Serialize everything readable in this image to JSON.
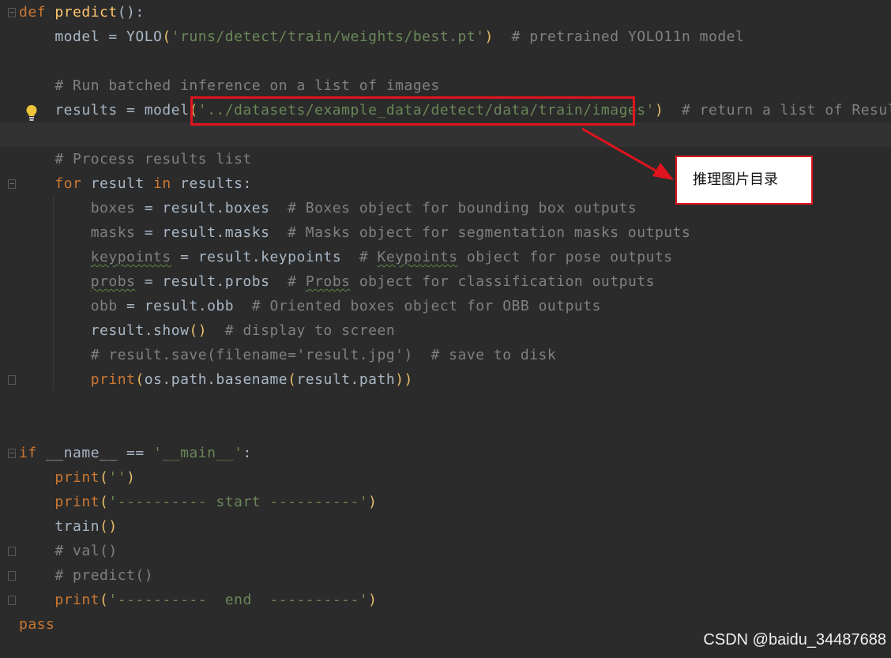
{
  "editor": {
    "lines": [
      {
        "segments": [
          {
            "t": "def",
            "c": "kw"
          },
          {
            "t": " "
          },
          {
            "t": "predict",
            "c": "fn"
          },
          {
            "t": "():"
          }
        ]
      },
      {
        "segments": [
          {
            "t": "    model = "
          },
          {
            "t": "YOLO",
            "c": "id"
          },
          {
            "t": "(",
            "c": "par"
          },
          {
            "t": "'runs/detect/train/weights/best.pt'",
            "c": "str"
          },
          {
            "t": ")",
            "c": "par"
          },
          {
            "t": "  # pretrained YOLO11n model",
            "c": "cmt"
          }
        ]
      },
      {
        "segments": []
      },
      {
        "segments": [
          {
            "t": "    # Run batched inference on a list of images",
            "c": "cmt"
          }
        ]
      },
      {
        "segments": [
          {
            "t": "    results = model"
          },
          {
            "t": "(",
            "c": "par"
          },
          {
            "t": "'../datasets/example_data/detect/data/train/images'",
            "c": "str"
          },
          {
            "t": ")",
            "c": "par"
          },
          {
            "t": "  # return a list of Results objects",
            "c": "cmt"
          }
        ]
      },
      {
        "segments": [],
        "current": true
      },
      {
        "segments": [
          {
            "t": "    # Process results list",
            "c": "cmt"
          }
        ]
      },
      {
        "segments": [
          {
            "t": "    "
          },
          {
            "t": "for",
            "c": "kw"
          },
          {
            "t": " result "
          },
          {
            "t": "in",
            "c": "kw"
          },
          {
            "t": " results:"
          }
        ]
      },
      {
        "segments": [
          {
            "t": "        "
          },
          {
            "t": "boxes",
            "c": "dim"
          },
          {
            "t": " = result.boxes"
          },
          {
            "t": "  # Boxes object for bounding box outputs",
            "c": "cmt"
          }
        ]
      },
      {
        "segments": [
          {
            "t": "        "
          },
          {
            "t": "masks",
            "c": "dim"
          },
          {
            "t": " = result.masks"
          },
          {
            "t": "  # Masks object for segmentation masks outputs",
            "c": "cmt"
          }
        ]
      },
      {
        "segments": [
          {
            "t": "        "
          },
          {
            "t": "keypoints",
            "c": "dim typo"
          },
          {
            "t": " = result.keypoints"
          },
          {
            "t": "  # ",
            "c": "cmt"
          },
          {
            "t": "Keypoints",
            "c": "cmt typo"
          },
          {
            "t": " object for pose outputs",
            "c": "cmt"
          }
        ]
      },
      {
        "segments": [
          {
            "t": "        "
          },
          {
            "t": "probs",
            "c": "dim typo"
          },
          {
            "t": " = result.probs"
          },
          {
            "t": "  # ",
            "c": "cmt"
          },
          {
            "t": "Probs",
            "c": "cmt typo"
          },
          {
            "t": " object for classification outputs",
            "c": "cmt"
          }
        ]
      },
      {
        "segments": [
          {
            "t": "        "
          },
          {
            "t": "obb",
            "c": "dim"
          },
          {
            "t": " = result.obb"
          },
          {
            "t": "  # Oriented boxes object for OBB outputs",
            "c": "cmt"
          }
        ]
      },
      {
        "segments": [
          {
            "t": "        result.show"
          },
          {
            "t": "()",
            "c": "par"
          },
          {
            "t": "  # display to screen",
            "c": "cmt"
          }
        ]
      },
      {
        "segments": [
          {
            "t": "        # result.save(filename='result.jpg')  # save to disk",
            "c": "cmt"
          }
        ]
      },
      {
        "segments": [
          {
            "t": "        "
          },
          {
            "t": "print",
            "c": "kw"
          },
          {
            "t": "(",
            "c": "par"
          },
          {
            "t": "os.path.basename"
          },
          {
            "t": "(",
            "c": "par"
          },
          {
            "t": "result.path"
          },
          {
            "t": "))",
            "c": "par"
          }
        ]
      },
      {
        "segments": []
      },
      {
        "segments": []
      },
      {
        "segments": [
          {
            "t": "if",
            "c": "kw"
          },
          {
            "t": " __name__ == "
          },
          {
            "t": "'__main__'",
            "c": "str"
          },
          {
            "t": ":"
          }
        ]
      },
      {
        "segments": [
          {
            "t": "    "
          },
          {
            "t": "print",
            "c": "kw"
          },
          {
            "t": "(",
            "c": "par"
          },
          {
            "t": "''",
            "c": "str"
          },
          {
            "t": ")",
            "c": "par"
          }
        ]
      },
      {
        "segments": [
          {
            "t": "    "
          },
          {
            "t": "print",
            "c": "kw"
          },
          {
            "t": "(",
            "c": "par"
          },
          {
            "t": "'---------- start ----------'",
            "c": "str"
          },
          {
            "t": ")",
            "c": "par"
          }
        ]
      },
      {
        "segments": [
          {
            "t": "    train"
          },
          {
            "t": "()",
            "c": "par"
          }
        ]
      },
      {
        "segments": [
          {
            "t": "    # val()",
            "c": "cmt"
          }
        ]
      },
      {
        "segments": [
          {
            "t": "    # predict()",
            "c": "cmt"
          }
        ]
      },
      {
        "segments": [
          {
            "t": "    "
          },
          {
            "t": "print",
            "c": "kw"
          },
          {
            "t": "(",
            "c": "par"
          },
          {
            "t": "'----------  end  ----------'",
            "c": "str"
          },
          {
            "t": ")",
            "c": "par"
          }
        ]
      },
      {
        "segments": [
          {
            "t": "pass",
            "c": "kw"
          }
        ]
      }
    ]
  },
  "annotation": {
    "callout_label": "推理图片目录",
    "highlight_color": "#e0141e"
  },
  "icons": {
    "intention": "lightbulb-icon",
    "fold": "fold-marker-icon"
  },
  "watermark": {
    "text": "CSDN @baidu_34487688"
  }
}
